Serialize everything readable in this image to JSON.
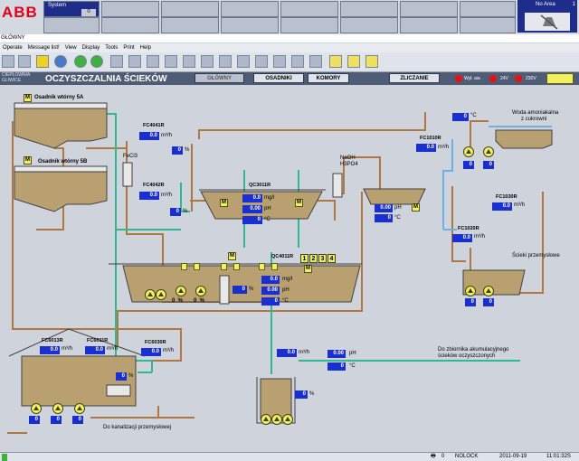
{
  "header": {
    "logo": "ABB",
    "system_label": "System",
    "system_value": "0",
    "no_area_label": "No Area",
    "no_area_value": "1"
  },
  "window_title": "GŁÓWNY",
  "menu": [
    "Operate",
    "Message list!",
    "View",
    "Display",
    "Tools",
    "Print",
    "Help"
  ],
  "nav": {
    "plant_small_1": "CIEPŁOWNIA",
    "plant_small_2": "GLIWICE",
    "title": "OCZYSZCZALNIA ŚCIEKÓW",
    "buttons": [
      "GŁÓWNY",
      "OSADNIKI",
      "KOMORY",
      "ZLICZANIE"
    ],
    "indicators": [
      "Wył. aw.",
      "24V",
      "230V"
    ]
  },
  "labels": {
    "osadnik_5a": "Osadnik wtórny 5A",
    "osadnik_5b": "Osadnik wtórny 5B",
    "fecl3": "FeCl3",
    "naoh": "NaOH",
    "h3po4": "H3PO4",
    "woda": "Woda amoniakalna",
    "woda2": "z cukrowni",
    "scieki": "Ścieki przemysłowe",
    "zbiornik1": "Do zbiornika akumulacyjnego",
    "zbiornik2": "ścieków oczyszczonych",
    "kanalizacja": "Do kanalizacji przemysłowej"
  },
  "instruments": {
    "fc4041r": {
      "tag": "FC4041R",
      "flow": "0.0",
      "pct": "0"
    },
    "fc4042r": {
      "tag": "FC4042R",
      "flow": "0.0",
      "pct": "0"
    },
    "qc3011r": {
      "tag": "QC3011R",
      "mg": "0.0",
      "ph": "0.00",
      "temp": "0"
    },
    "qc4011r": {
      "tag": "QC4011R",
      "mg": "0.0",
      "ph": "0.00",
      "temp": "0",
      "pct": "0"
    },
    "mid_tank": {
      "ph": "0.00",
      "temp": "0"
    },
    "fc1010r": {
      "tag": "FC1010R",
      "flow": "0.0"
    },
    "fc1030r": {
      "tag": "FC1030R",
      "flow": "0.0"
    },
    "fc1020r": {
      "tag": "FC1020R",
      "flow": "0.0"
    },
    "amoniak_temp": {
      "temp": "0"
    },
    "fc6013r": {
      "tag": "FC6013R",
      "flow": "0.0"
    },
    "fc6011r": {
      "tag": "FC6011R",
      "flow": "0.0"
    },
    "fc6030r": {
      "tag": "FC6030R",
      "flow": "0.0"
    },
    "outlet": {
      "flow": "0.0",
      "ph": "0.00",
      "temp": "0"
    },
    "akum": {
      "pct": "0"
    },
    "left_bottom": {
      "pct": "0"
    }
  },
  "units": {
    "flow": "m³/h",
    "mg": "mg/l",
    "ph": "pH",
    "degC": "°C",
    "pct": "%"
  },
  "status": {
    "printer": "0",
    "nolock": "NOLOCK",
    "date": "2011-09-19",
    "time": "11:01:32S"
  },
  "colors": {
    "value_bg": "#1a2fd0",
    "pipe_brown": "#b07840",
    "pipe_green": "#30b890",
    "pipe_blue": "#70b0e0",
    "yellow": "#f0f060"
  }
}
